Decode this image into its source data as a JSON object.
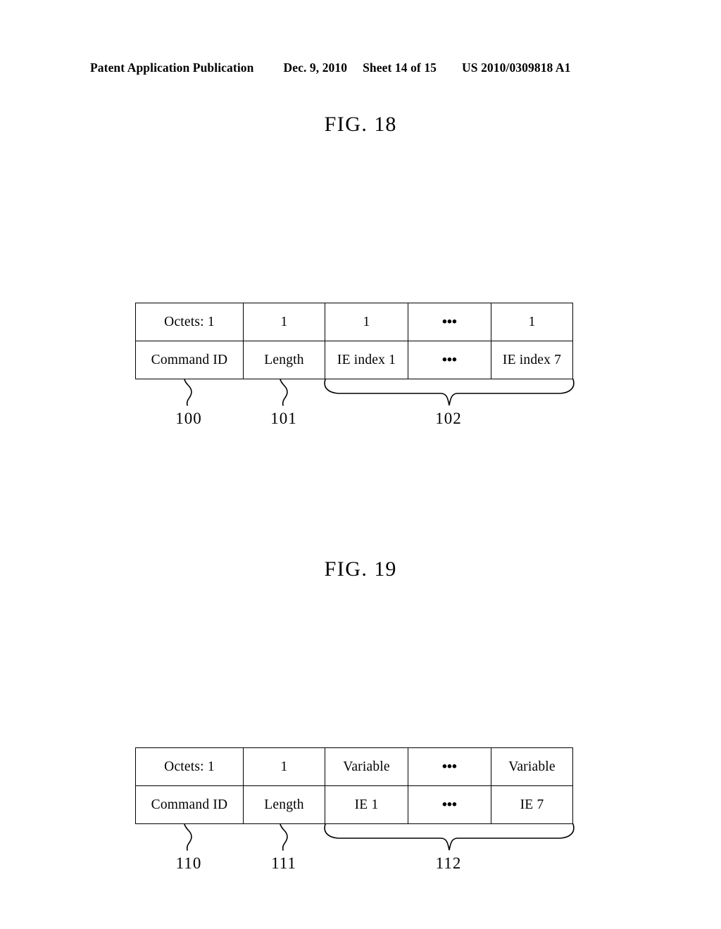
{
  "header": {
    "publication": "Patent Application Publication",
    "date": "Dec. 9, 2010",
    "sheet": "Sheet 14 of 15",
    "patent_number": "US 2010/0309818 A1"
  },
  "figures": [
    {
      "id": "fig-18",
      "title_word": "FIG.",
      "title_number": "18",
      "table": {
        "rows": [
          {
            "name": "octets-row",
            "cells": [
              "Octets: 1",
              "1",
              "1",
              "•••",
              "1"
            ]
          },
          {
            "name": "field-row",
            "cells": [
              "Command ID",
              "Length",
              "IE index 1",
              "•••",
              "IE index 7"
            ]
          }
        ]
      },
      "references": [
        {
          "label": "100",
          "type": "leader-squiggle",
          "target": "Command ID"
        },
        {
          "label": "101",
          "type": "leader-squiggle",
          "target": "Length"
        },
        {
          "label": "102",
          "type": "brace",
          "target": "IE index 1 ... IE index 7"
        }
      ]
    },
    {
      "id": "fig-19",
      "title_word": "FIG.",
      "title_number": "19",
      "table": {
        "rows": [
          {
            "name": "octets-row",
            "cells": [
              "Octets: 1",
              "1",
              "Variable",
              "•••",
              "Variable"
            ]
          },
          {
            "name": "field-row",
            "cells": [
              "Command ID",
              "Length",
              "IE 1",
              "•••",
              "IE 7"
            ]
          }
        ]
      },
      "references": [
        {
          "label": "110",
          "type": "leader-squiggle",
          "target": "Command ID"
        },
        {
          "label": "111",
          "type": "leader-squiggle",
          "target": "Length"
        },
        {
          "label": "112",
          "type": "brace",
          "target": "IE 1 ... IE 7"
        }
      ]
    }
  ],
  "colors": {
    "ink": "#000000",
    "paper": "#ffffff"
  }
}
